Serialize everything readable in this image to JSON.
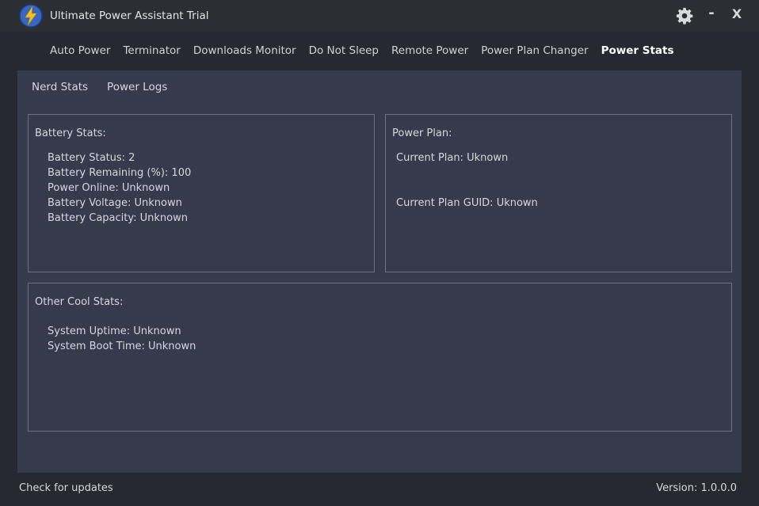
{
  "app": {
    "title": "Ultimate Power Assistant Trial"
  },
  "window_controls": {
    "minimize": "-",
    "close": "X"
  },
  "nav": {
    "tabs": [
      {
        "label": "Auto Power"
      },
      {
        "label": "Terminator"
      },
      {
        "label": "Downloads Monitor"
      },
      {
        "label": "Do Not Sleep"
      },
      {
        "label": "Remote Power"
      },
      {
        "label": "Power Plan Changer"
      },
      {
        "label": "Power Stats",
        "active": true
      }
    ]
  },
  "subnav": {
    "items": [
      {
        "label": "Nerd Stats"
      },
      {
        "label": "Power Logs"
      }
    ]
  },
  "battery": {
    "title": "Battery Stats:",
    "status": "Battery Status: 2",
    "remaining": "Battery Remaining (%): 100",
    "power_online": "Power Online: Unknown",
    "voltage": "Battery Voltage: Unknown",
    "capacity": "Battery Capacity: Unknown"
  },
  "power_plan": {
    "title": "Power Plan:",
    "current_plan": "Current Plan: Uknown",
    "current_plan_guid": "Current Plan GUID: Uknown"
  },
  "other": {
    "title": "Other Cool Stats:",
    "uptime": "System Uptime: Unknown",
    "boot_time": "System Boot Time: Unknown"
  },
  "footer": {
    "check_updates": "Check for updates",
    "version": "Version: 1.0.0.0"
  },
  "colors": {
    "titlebar_bg": "#2b2e33",
    "window_bg": "#262a30",
    "panel_bg": "#353a4d",
    "box_border": "#6b7282",
    "logo_bg": "#3a66c2",
    "logo_bolt": "#f5c21b"
  }
}
